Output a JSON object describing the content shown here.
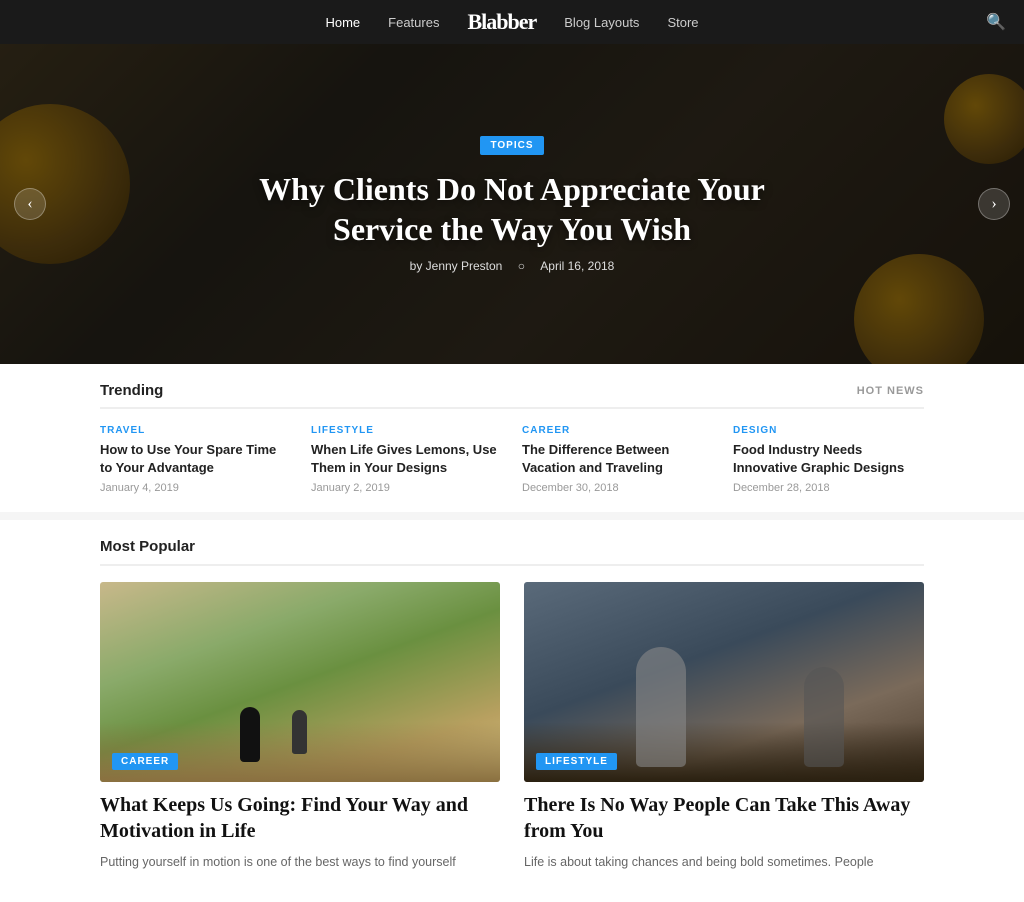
{
  "nav": {
    "logo": "Blabber",
    "links": [
      {
        "label": "Home",
        "active": true
      },
      {
        "label": "Features",
        "active": false
      },
      {
        "label": "Blog Layouts",
        "active": false
      },
      {
        "label": "Store",
        "active": false
      }
    ],
    "search_icon": "🔍"
  },
  "hero": {
    "tag": "TOPICS",
    "title": "Why Clients Do Not Appreciate Your Service the Way You Wish",
    "author": "by Jenny Preston",
    "date": "April 16, 2018",
    "arrow_left": "‹",
    "arrow_right": "›"
  },
  "trending": {
    "section_title": "Trending",
    "hot_news_label": "HOT NEWS",
    "items": [
      {
        "category": "TRAVEL",
        "cat_class": "cat-travel",
        "headline": "How to Use Your Spare Time to Your Advantage",
        "date": "January 4, 2019"
      },
      {
        "category": "LIFESTYLE",
        "cat_class": "cat-lifestyle",
        "headline": "When Life Gives Lemons, Use Them in Your Designs",
        "date": "January 2, 2019"
      },
      {
        "category": "CAREER",
        "cat_class": "cat-career",
        "headline": "The Difference Between Vacation and Traveling",
        "date": "December 30, 2018"
      },
      {
        "category": "DESIGN",
        "cat_class": "cat-design",
        "headline": "Food Industry Needs Innovative Graphic Designs",
        "date": "December 28, 2018"
      }
    ]
  },
  "most_popular": {
    "section_title": "Most Popular",
    "articles": [
      {
        "category": "CAREER",
        "badge_class": "badge-career",
        "title": "What Keeps Us Going: Find Your Way and Motivation in Life",
        "excerpt": "Putting yourself in motion is one of the best ways to find yourself"
      },
      {
        "category": "LIFESTYLE",
        "badge_class": "badge-lifestyle",
        "title": "There Is No Way People Can Take This Away from You",
        "excerpt": "Life is about taking chances and being bold sometimes. People"
      }
    ]
  }
}
